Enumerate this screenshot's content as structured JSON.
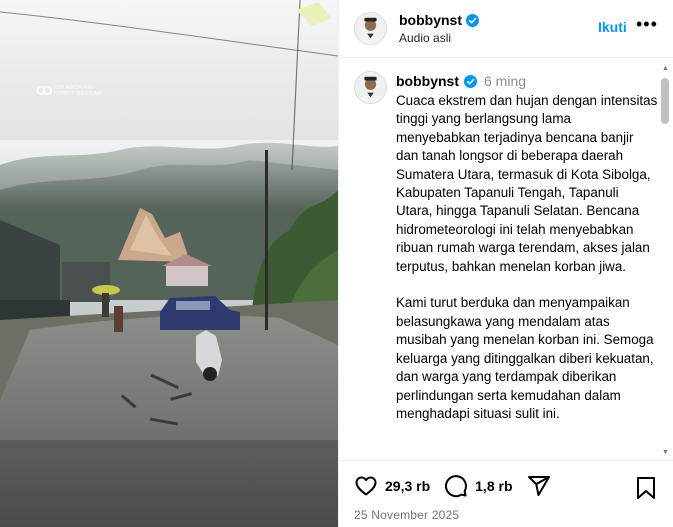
{
  "media": {
    "watermark_mark": "CO",
    "watermark_line1": "KOLABORASI",
    "watermark_line2": "SUMUT BERKAH"
  },
  "header": {
    "username": "bobbynst",
    "audio": "Audio asli",
    "follow_label": "Ikuti",
    "more_label": "•••"
  },
  "caption": {
    "username": "bobbynst",
    "age": "6 ming",
    "text": "Cuaca ekstrem dan hujan dengan intensitas tinggi yang berlangsung lama menyebabkan terjadinya bencana banjir dan tanah longsor di beberapa daerah Sumatera Utara, termasuk di Kota Sibolga, Kabupaten Tapanuli Tengah, Tapanuli Utara, hingga Tapanuli Selatan. Bencana hidrometeorologi ini telah menyebabkan ribuan rumah warga terendam, akses jalan terputus, bahkan menelan korban jiwa.\n\nKami turut berduka dan menyampaikan belasungkawa yang mendalam atas musibah yang menelan korban ini. Semoga keluarga yang ditinggalkan diberi kekuatan, dan warga yang terdampak diberikan perlindungan serta kemudahan dalam menghadapi situasi sulit ini."
  },
  "footer": {
    "likes": "29,3 rb",
    "comments": "1,8 rb",
    "date": "25 November 2025"
  },
  "colors": {
    "accent": "#0095f6",
    "verified": "#0095f6",
    "secondary_text": "#737373"
  },
  "icons": [
    "verified-badge-icon",
    "heart-icon",
    "comment-icon",
    "share-icon",
    "bookmark-icon",
    "more-icon",
    "scroll-up-icon",
    "scroll-down-icon"
  ]
}
